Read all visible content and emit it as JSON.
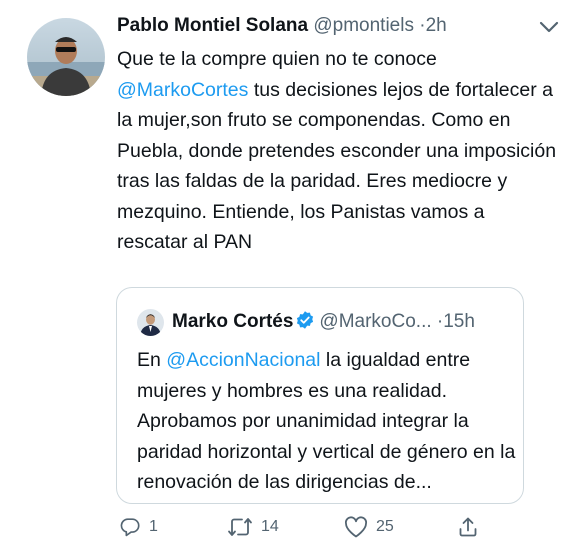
{
  "tweet": {
    "author_name": "Pablo Montiel Solana",
    "handle": "@pmontiels",
    "separator": "·",
    "time": "2h",
    "text_part1": "Que te la compre quien no te conoce",
    "mention": "@MarkoCortes",
    "text_part2": " tus decisiones lejos de fortalecer a la mujer,son fruto se componendas. Como en Puebla, donde pretendes esconder una imposición tras las faldas de la paridad. Eres mediocre y mezquino. Entiende, los Panistas vamos a rescatar al PAN"
  },
  "quoted": {
    "author_name": "Marko Cortés",
    "handle": "@MarkoCo...",
    "time_prefix": "·15h",
    "text_part1": "En ",
    "mention": "@AccionNacional",
    "text_part2": " la igualdad entre mujeres y hombres es una realidad. Aprobamos por unanimidad integrar la paridad horizontal y vertical de género en la renovación de las dirigencias de..."
  },
  "actions": {
    "reply_count": "1",
    "retweet_count": "14",
    "like_count": "25"
  },
  "colors": {
    "link": "#1d9bf0",
    "secondary": "#536471",
    "verified": "#1d9bf0"
  }
}
